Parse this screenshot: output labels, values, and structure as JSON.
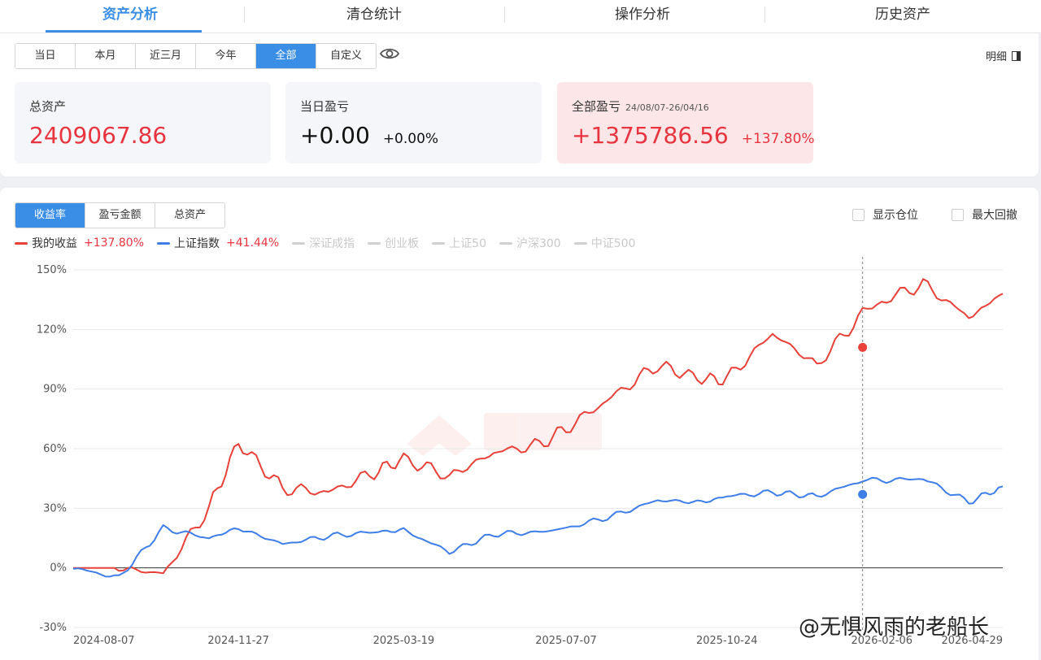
{
  "top_tabs": [
    {
      "label": "资产分析",
      "active": true
    },
    {
      "label": "清仓统计",
      "active": false
    },
    {
      "label": "操作分析",
      "active": false
    },
    {
      "label": "历史资产",
      "active": false
    }
  ],
  "periods": [
    "当日",
    "本月",
    "近三月",
    "今年",
    "全部",
    "自定义"
  ],
  "selected_period": "全部",
  "detail_label": "明细",
  "cards": {
    "total_assets": {
      "label": "总资产",
      "value": "2409067.86"
    },
    "daily_pnl": {
      "label": "当日盈亏",
      "value": "+0.00",
      "pct": "+0.00%"
    },
    "total_pnl": {
      "label": "全部盈亏",
      "range": "24/08/07-26/04/16",
      "value": "+1375786.56",
      "pct": "+137.80%"
    }
  },
  "metric_tabs": [
    "收益率",
    "盈亏金额",
    "总资产"
  ],
  "selected_metric": "收益率",
  "options": {
    "show_position": "显示仓位",
    "max_drawdown": "最大回撤"
  },
  "legend": [
    {
      "name": "我的收益",
      "value": "+137.80%",
      "color": "#e8413a",
      "active": true
    },
    {
      "name": "上证指数",
      "value": "+41.44%",
      "color": "#3f7ee8",
      "active": true
    },
    {
      "name": "深证成指",
      "value": "",
      "color": "#d0d0d0",
      "active": false
    },
    {
      "name": "创业板",
      "value": "",
      "color": "#d0d0d0",
      "active": false
    },
    {
      "name": "上证50",
      "value": "",
      "color": "#d0d0d0",
      "active": false
    },
    {
      "name": "沪深300",
      "value": "",
      "color": "#d0d0d0",
      "active": false
    },
    {
      "name": "中证500",
      "value": "",
      "color": "#d0d0d0",
      "active": false
    }
  ],
  "watermark_text": "@无惧风雨的老船长",
  "chart_data": {
    "type": "line",
    "x": [
      "2024-08-07",
      "2024-09-07",
      "2024-10-07",
      "2024-11-07",
      "2024-11-27",
      "2024-12-27",
      "2025-01-27",
      "2025-02-27",
      "2025-03-19",
      "2025-04-19",
      "2025-05-19",
      "2025-06-19",
      "2025-07-07",
      "2025-08-07",
      "2025-09-07",
      "2025-10-07",
      "2025-10-24",
      "2025-11-24",
      "2025-12-24",
      "2026-01-24",
      "2026-02-06",
      "2026-03-06",
      "2026-04-06",
      "2026-04-29"
    ],
    "xticks": [
      "2024-08-07",
      "2024-11-27",
      "2025-03-19",
      "2025-07-07",
      "2025-10-24",
      "2026-02-06",
      "2026-04-29"
    ],
    "yticks": [
      "150%",
      "120%",
      "90%",
      "60%",
      "30%",
      "0%",
      "-30%"
    ],
    "ylim": [
      -30,
      150
    ],
    "grid": true,
    "series": [
      {
        "name": "我的收益",
        "color": "#e8413a",
        "values": [
          0,
          0,
          -3,
          30,
          63,
          40,
          38,
          48,
          55,
          46,
          58,
          62,
          70,
          86,
          102,
          95,
          95,
          118,
          102,
          128,
          134,
          143,
          126,
          138
        ]
      },
      {
        "name": "上证指数",
        "color": "#3f7ee8",
        "values": [
          0,
          -5,
          20,
          15,
          20,
          12,
          16,
          18,
          19,
          8,
          17,
          18,
          20,
          26,
          34,
          33,
          36,
          38,
          36,
          44,
          44,
          45,
          33,
          41
        ]
      }
    ],
    "cursor": {
      "x": "2026-01-24",
      "values": [
        111,
        37
      ]
    }
  }
}
